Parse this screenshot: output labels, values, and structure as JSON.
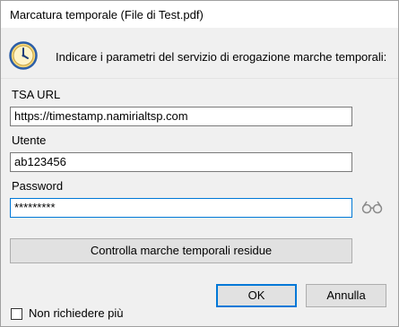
{
  "window": {
    "title": "Marcatura temporale (File di Test.pdf)"
  },
  "header": {
    "icon": "clock-icon",
    "instruction": "Indicare i parametri del servizio di erogazione marche temporali:"
  },
  "form": {
    "tsa_url_label": "TSA URL",
    "tsa_url_value": "https://timestamp.namirialtsp.com",
    "user_label": "Utente",
    "user_value": "ab123456",
    "password_label": "Password",
    "password_value": "*********",
    "show_password_icon": "glasses-icon"
  },
  "buttons": {
    "check_label": "Controlla marche temporali residue",
    "ok_label": "OK",
    "cancel_label": "Annulla"
  },
  "options": {
    "dont_ask_label": "Non richiedere più",
    "dont_ask_checked": false
  },
  "colors": {
    "focus_border": "#0078d7",
    "clock_face": "#f5d77a",
    "clock_border": "#2b5ea8"
  }
}
